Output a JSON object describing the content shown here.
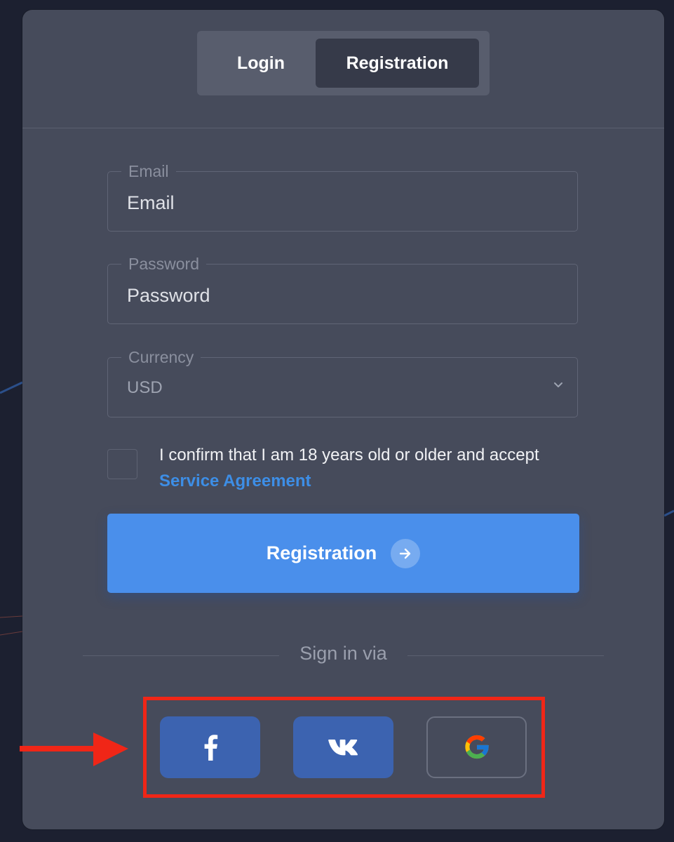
{
  "tabs": {
    "login_label": "Login",
    "registration_label": "Registration",
    "active": "Registration"
  },
  "form": {
    "email": {
      "legend": "Email",
      "placeholder": "Email"
    },
    "password": {
      "legend": "Password",
      "placeholder": "Password"
    },
    "currency": {
      "legend": "Currency",
      "value": "USD"
    },
    "confirm_text": "I confirm that I am 18 years old or older and accept",
    "service_link": "Service Agreement",
    "submit_label": "Registration"
  },
  "social": {
    "heading": "Sign in via",
    "providers": [
      {
        "name": "facebook",
        "icon": "facebook-icon"
      },
      {
        "name": "vk",
        "icon": "vk-icon"
      },
      {
        "name": "google",
        "icon": "google-icon"
      }
    ]
  },
  "colors": {
    "card_bg": "#464b5b",
    "accent_blue": "#4a8feb",
    "link_blue": "#3d8ee6",
    "social_blue": "#3c63b0",
    "highlight_red": "#f02617"
  }
}
